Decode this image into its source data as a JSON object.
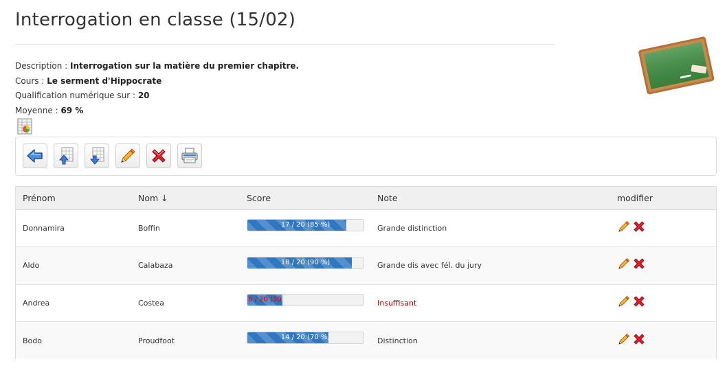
{
  "page": {
    "title": "Interrogation en classe (15/02)"
  },
  "info": {
    "description_label": "Description : ",
    "description_value": "Interrogation sur la matière du premier chapitre.",
    "course_label": "Cours : ",
    "course_value": "Le serment d'Hippocrate",
    "qualification_label": "Qualification numérique sur : ",
    "qualification_value": "20",
    "average_label": "Moyenne : ",
    "average_value": "69 %"
  },
  "toolbar": {
    "buttons": [
      "back-icon",
      "import-icon",
      "export-icon",
      "edit-icon",
      "delete-icon",
      "print-icon"
    ]
  },
  "table": {
    "headers": {
      "firstname": "Prénom",
      "lastname": "Nom ↓",
      "score": "Score",
      "note": "Note",
      "edit": "modifier"
    },
    "rows": [
      {
        "firstname": "Donnamira",
        "lastname": "Boffin",
        "score_label": "17 / 20 (85 %)",
        "score_fraction": 0.85,
        "note": "Grande distinction",
        "status": "ok"
      },
      {
        "firstname": "Aldo",
        "lastname": "Calabaza",
        "score_label": "18 / 20 (90 %)",
        "score_fraction": 0.9,
        "note": "Grande dis avec fél. du jury",
        "status": "ok"
      },
      {
        "firstname": "Andrea",
        "lastname": "Costea",
        "score_label": "6 / 20 (30",
        "score_fraction": 0.3,
        "note": "Insuffisant",
        "status": "fail"
      },
      {
        "firstname": "Bodo",
        "lastname": "Proudfoot",
        "score_label": "14 / 20 (70 %)",
        "score_fraction": 0.7,
        "note": "Distinction",
        "status": "ok"
      }
    ]
  },
  "colors": {
    "bar_fill": "#2f77c0",
    "fail_text": "#cc0000",
    "header_bg": "#f0f0f0"
  }
}
